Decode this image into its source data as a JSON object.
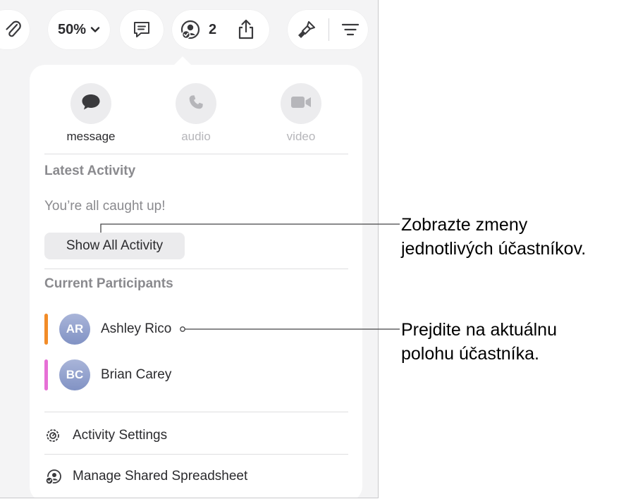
{
  "toolbar": {
    "zoom": "50%",
    "collaborator_count": "2",
    "icons": [
      "paperclip-icon",
      "chevron-down-icon",
      "comment-icon",
      "collaborate-icon",
      "share-icon",
      "format-brush-icon",
      "organize-icon"
    ]
  },
  "popover": {
    "contact_actions": [
      {
        "label": "message",
        "icon": "message-bubble-icon",
        "enabled": true
      },
      {
        "label": "audio",
        "icon": "phone-icon",
        "enabled": false
      },
      {
        "label": "video",
        "icon": "video-camera-icon",
        "enabled": false
      }
    ],
    "latest_activity": {
      "heading": "Latest Activity",
      "status": "You’re all caught up!",
      "button": "Show All Activity"
    },
    "participants": {
      "heading": "Current Participants",
      "items": [
        {
          "initials": "AR",
          "name": "Ashley Rico",
          "color": "#f28c28"
        },
        {
          "initials": "BC",
          "name": "Brian Carey",
          "color": "#e670d6"
        }
      ]
    },
    "menu": [
      {
        "label": "Activity Settings",
        "icon": "activity-settings-icon"
      },
      {
        "label": "Manage Shared Spreadsheet",
        "icon": "manage-shared-icon"
      }
    ]
  },
  "callouts": [
    {
      "line1": "Zobrazte zmeny",
      "line2": "jednotlivých účastníkov."
    },
    {
      "line1": "Prejdite na aktuálnu",
      "line2": "polohu účastníka."
    }
  ]
}
